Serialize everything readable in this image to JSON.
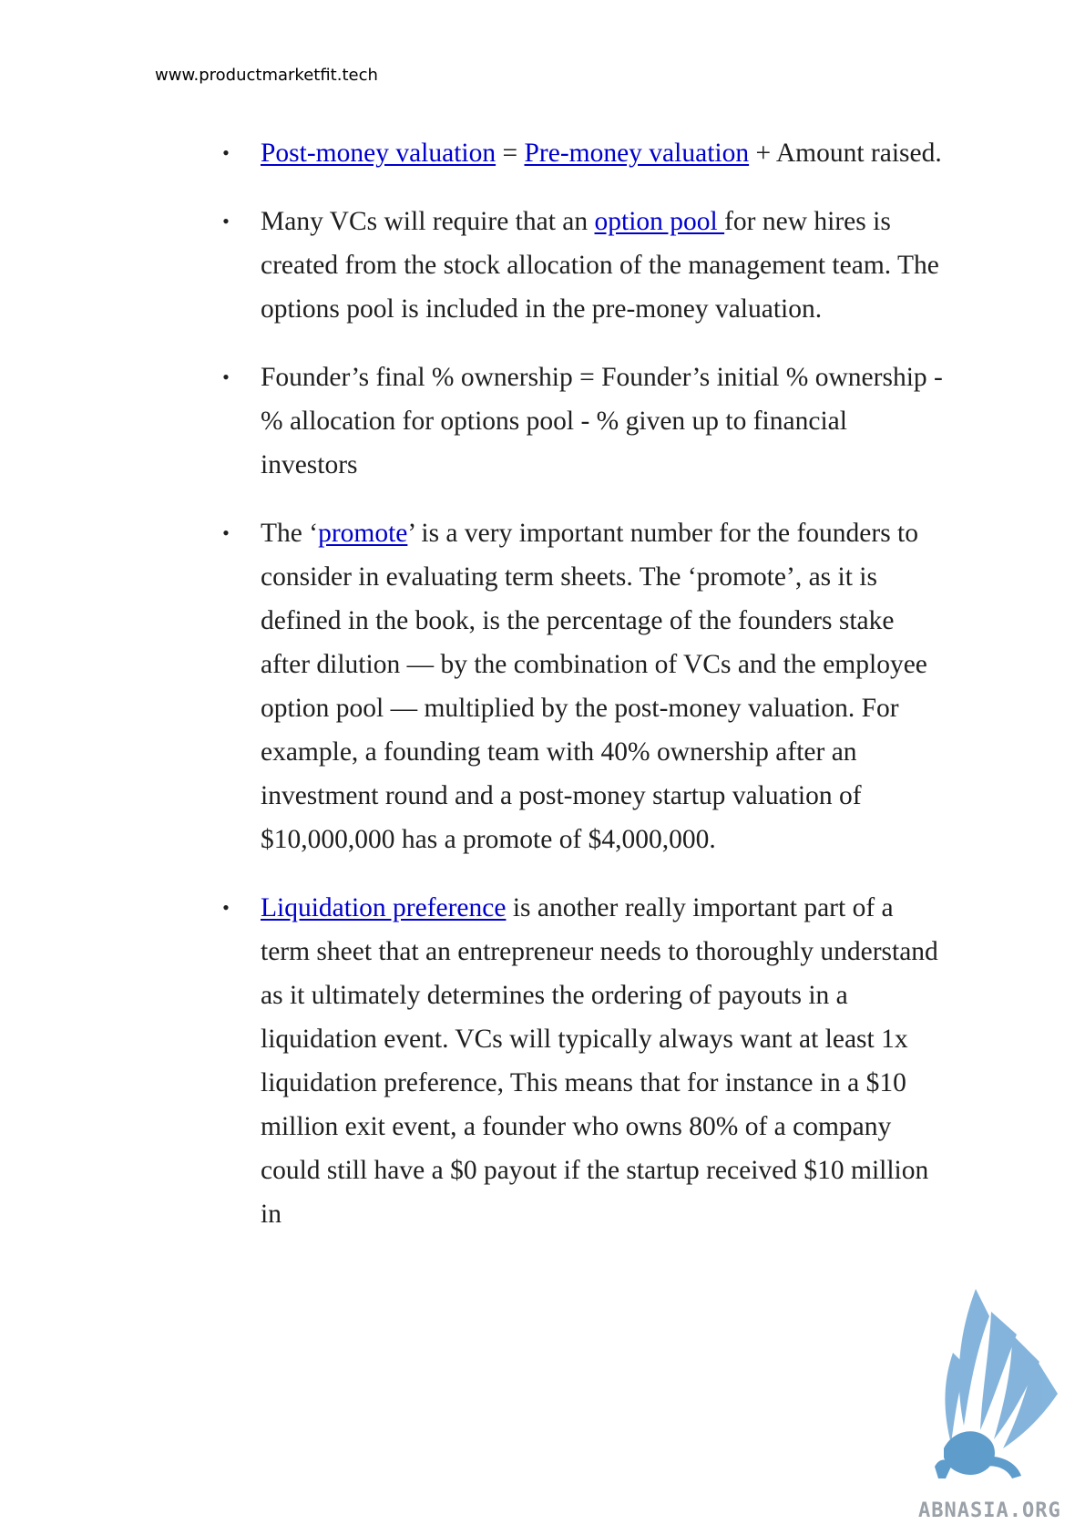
{
  "header": {
    "url": "www.productmarketfit.tech"
  },
  "bullets": [
    {
      "parts": [
        {
          "link": "Post-money valuation"
        },
        {
          "text": " = "
        },
        {
          "link": "Pre-money valuation"
        },
        {
          "text": " + Amount raised."
        }
      ]
    },
    {
      "parts": [
        {
          "text": "Many VCs will require that an "
        },
        {
          "link": "option pool "
        },
        {
          "text": "for new hires is created from the stock allocation of the management team. The options pool is included in the pre-money valuation."
        }
      ]
    },
    {
      "parts": [
        {
          "text": "Founder’s final % ownership = Founder’s initial % ownership - % allocation for options pool - % given up to financial investors"
        }
      ]
    },
    {
      "parts": [
        {
          "text": "The ‘"
        },
        {
          "link": "promote"
        },
        {
          "text": "’ is a very important number for the founders to consider in evaluating term sheets. The ‘promote’, as it is defined in the book, is the percentage of the founders stake after dilution — by the combination of VCs and the employee option pool — multiplied by the post-money valuation. For example, a founding team with 40% ownership after an investment round and a post-money startup valuation of $10,000,000 has a promote of $4,000,000."
        }
      ]
    },
    {
      "parts": [
        {
          "link": "Liquidation preference"
        },
        {
          "text": " is another really important part of a term sheet that an entrepreneur needs to thoroughly understand as it ultimately determines the ordering of payouts in a liquidation event. VCs will typically always want at least 1x liquidation preference, This means that for instance in a $10 million exit event, a founder who owns 80% of a company could still have a $0 payout if the startup received $10 million in"
        }
      ]
    }
  ],
  "bullet_glyph": "•",
  "logo": {
    "text": "ABNASIA.ORG",
    "icon": "griffin-logo-icon",
    "color": "#6fa8d6"
  }
}
